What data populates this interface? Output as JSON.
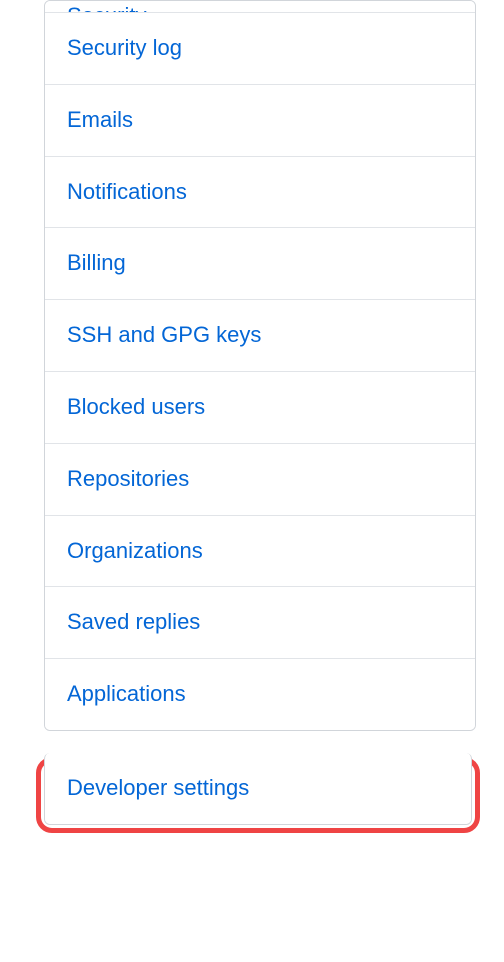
{
  "settings_menu": {
    "items": [
      {
        "label": "Security"
      },
      {
        "label": "Security log"
      },
      {
        "label": "Emails"
      },
      {
        "label": "Notifications"
      },
      {
        "label": "Billing"
      },
      {
        "label": "SSH and GPG keys"
      },
      {
        "label": "Blocked users"
      },
      {
        "label": "Repositories"
      },
      {
        "label": "Organizations"
      },
      {
        "label": "Saved replies"
      },
      {
        "label": "Applications"
      }
    ]
  },
  "developer_menu": {
    "items": [
      {
        "label": "Developer settings"
      }
    ]
  }
}
